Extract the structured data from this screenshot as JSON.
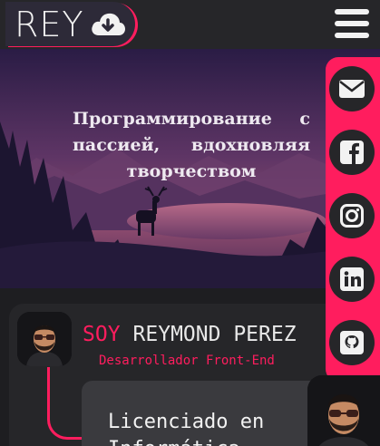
{
  "header": {
    "logo_text": "REY",
    "logo_icon": "cloud-download-icon",
    "menu_icon": "hamburger-menu-icon"
  },
  "hero": {
    "tagline": "Программирование с пассией, вдохновляя творчеством"
  },
  "social": {
    "items": [
      {
        "name": "email",
        "icon": "envelope-icon"
      },
      {
        "name": "facebook",
        "icon": "facebook-icon"
      },
      {
        "name": "instagram",
        "icon": "instagram-icon"
      },
      {
        "name": "linkedin",
        "icon": "linkedin-icon"
      },
      {
        "name": "github",
        "icon": "github-icon"
      }
    ]
  },
  "profile": {
    "soy": "SOY",
    "name": "REYMOND PEREZ",
    "role": "Desarrollador Front-End",
    "bio": "Licenciado en Informática"
  },
  "colors": {
    "accent": "#ff1d5e",
    "background": "#1e1e21",
    "panel": "#262629"
  }
}
